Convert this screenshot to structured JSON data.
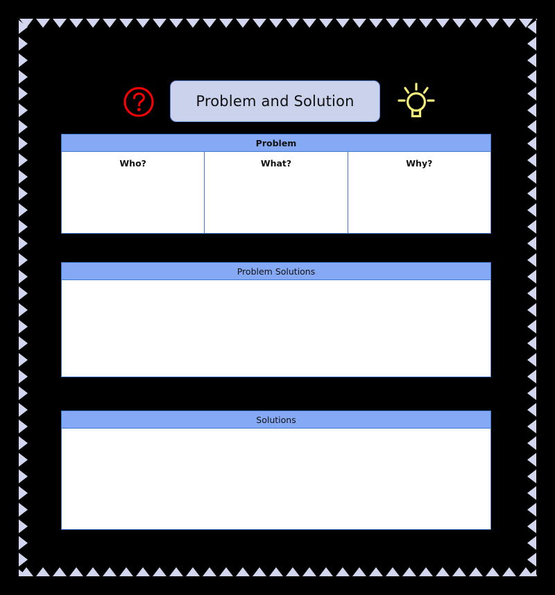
{
  "header": {
    "title": "Problem and Solution",
    "help_icon": "question-mark-circle-icon",
    "idea_icon": "lightbulb-icon"
  },
  "colors": {
    "background": "#000000",
    "header_bar_blue": "#85A9F5",
    "border_blue": "#4279D0",
    "pill_lavender": "#CBD2EC",
    "zigzag_lavender": "#D2D6EE",
    "panel_white": "#FFFFFF",
    "help_icon_red": "#FF0000",
    "bulb_icon_yellow": "#F5F07A"
  },
  "sections": [
    {
      "id": "problem",
      "heading": "Problem",
      "heading_bold": true,
      "columns": [
        {
          "label": "Who?",
          "value": ""
        },
        {
          "label": "What?",
          "value": ""
        },
        {
          "label": "Why?",
          "value": ""
        }
      ]
    },
    {
      "id": "problem-solutions",
      "heading": "Problem Solutions",
      "heading_bold": false,
      "value": ""
    },
    {
      "id": "solutions",
      "heading": "Solutions",
      "heading_bold": false,
      "value": ""
    }
  ]
}
